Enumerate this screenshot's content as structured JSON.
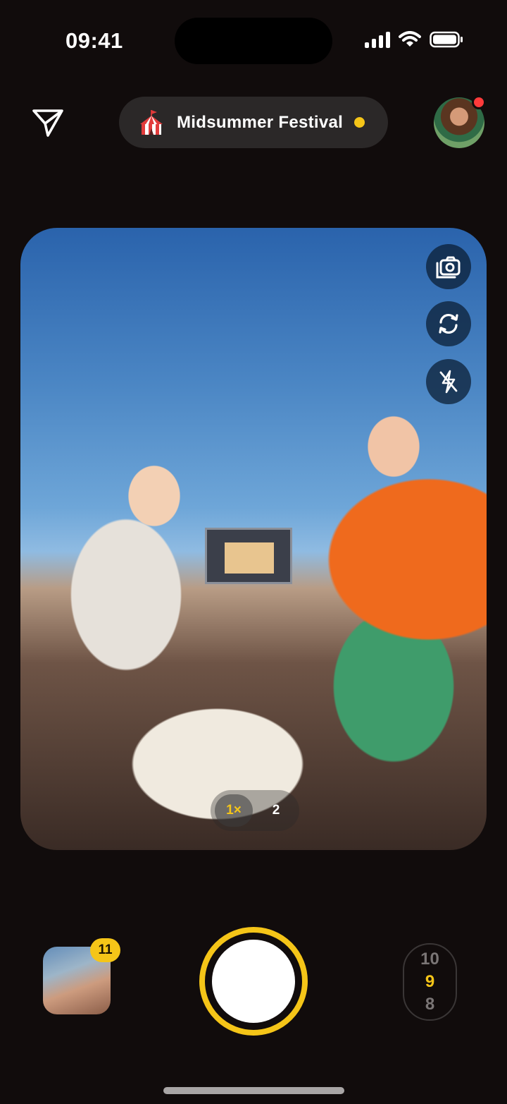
{
  "status_bar": {
    "time": "09:41"
  },
  "header": {
    "send_icon": "paper-plane-icon",
    "event": {
      "icon": "circus-tent-icon",
      "name": "Midsummer Festival",
      "live_indicator_color": "#f5c518"
    },
    "profile": {
      "icon": "avatar",
      "has_notification": true
    }
  },
  "viewfinder": {
    "controls": [
      {
        "name": "switch-camera-icon"
      },
      {
        "name": "rotate-icon"
      },
      {
        "name": "flash-off-icon"
      }
    ],
    "zoom": {
      "options": [
        "1×",
        "2"
      ],
      "selected": "1×"
    }
  },
  "bottom": {
    "gallery_count": "11",
    "shots_counter": {
      "prev": "10",
      "current": "9",
      "next": "8"
    }
  },
  "colors": {
    "accent": "#f5c518",
    "background": "#110c0c",
    "badge": "#ff3b3b"
  }
}
